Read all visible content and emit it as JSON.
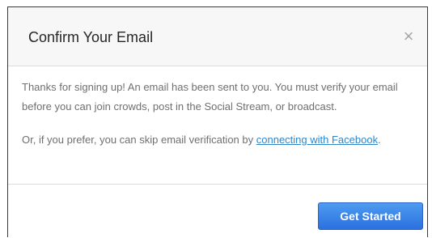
{
  "dialog": {
    "title": "Confirm Your Email",
    "close_glyph": "×",
    "message_1": "Thanks for signing up! An email has been sent to you. You must verify your email before you can join crowds, post in the Social Stream, or broadcast.",
    "message_2_prefix": "Or, if you prefer, you can skip email verification by ",
    "message_2_link": "connecting with Facebook",
    "message_2_suffix": ".",
    "primary_button_label": "Get Started"
  },
  "colors": {
    "header_background": "#f7f7f7",
    "link": "#2f86c9",
    "button_top": "#4e9cf0",
    "button_bottom": "#2b70de",
    "body_text": "#6f6f6f",
    "title_text": "#262626"
  },
  "icons": {
    "close": "close-icon"
  }
}
